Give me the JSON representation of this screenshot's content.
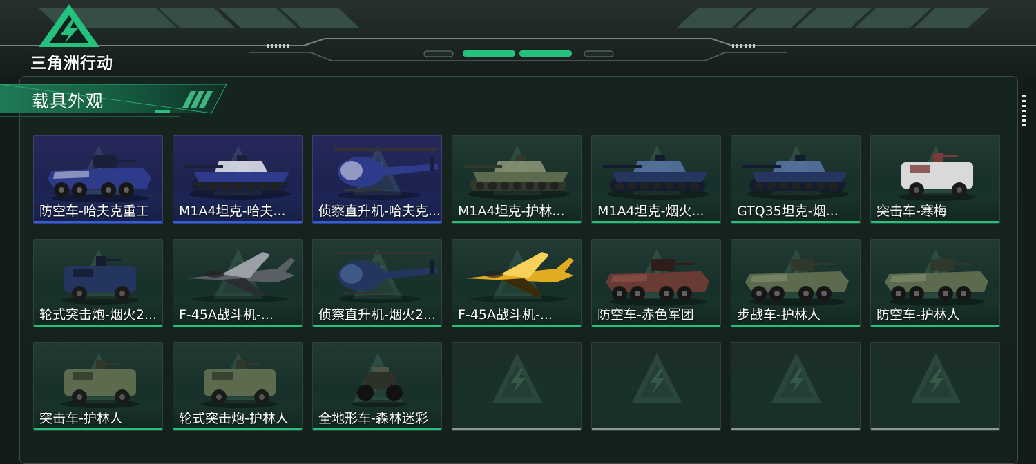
{
  "app": {
    "title": "三角洲行动"
  },
  "section": {
    "title": "载具外观"
  },
  "colors": {
    "accent": "#25c27e",
    "blue_rarity": "#2f5fe0",
    "empty": "#8d9894",
    "panel": "#16241f"
  },
  "vehicles": [
    {
      "label": "防空车-哈夫克重工",
      "rarity": "blue",
      "kind": "wheeled-aa",
      "palette": "hawk"
    },
    {
      "label": "M1A4坦克-哈夫...",
      "rarity": "blue",
      "kind": "tank",
      "palette": "hawk"
    },
    {
      "label": "侦察直升机-哈夫克...",
      "rarity": "blue",
      "kind": "heli",
      "palette": "hawk"
    },
    {
      "label": "M1A4坦克-护林...",
      "rarity": "green",
      "kind": "tank",
      "palette": "camo"
    },
    {
      "label": "M1A4坦克-烟火...",
      "rarity": "green",
      "kind": "tank",
      "palette": "navy"
    },
    {
      "label": "GTQ35坦克-烟...",
      "rarity": "green",
      "kind": "tank",
      "palette": "navy"
    },
    {
      "label": "突击车-寒梅",
      "rarity": "green",
      "kind": "mrap",
      "palette": "white"
    },
    {
      "label": "轮式突击炮-烟火2...",
      "rarity": "green",
      "kind": "mrap",
      "palette": "navy"
    },
    {
      "label": "F-45A战斗机-...",
      "rarity": "green",
      "kind": "jet",
      "palette": "digital"
    },
    {
      "label": "侦察直升机-烟火2...",
      "rarity": "green",
      "kind": "heli",
      "palette": "navy"
    },
    {
      "label": "F-45A战斗机-...",
      "rarity": "green",
      "kind": "jet",
      "palette": "yellow"
    },
    {
      "label": "防空车-赤色军团",
      "rarity": "green",
      "kind": "wheeled-aa",
      "palette": "red"
    },
    {
      "label": "步战车-护林人",
      "rarity": "green",
      "kind": "wheeled-aa",
      "palette": "camo"
    },
    {
      "label": "防空车-护林人",
      "rarity": "green",
      "kind": "wheeled-aa",
      "palette": "camo"
    },
    {
      "label": "突击车-护林人",
      "rarity": "green",
      "kind": "mrap",
      "palette": "camo"
    },
    {
      "label": "轮式突击炮-护林人",
      "rarity": "green",
      "kind": "mrap",
      "palette": "camo"
    },
    {
      "label": "全地形车-森林迷彩",
      "rarity": "green",
      "kind": "atv",
      "palette": "dark"
    },
    {
      "label": "",
      "rarity": "empty"
    },
    {
      "label": "",
      "rarity": "empty"
    },
    {
      "label": "",
      "rarity": "empty"
    },
    {
      "label": "",
      "rarity": "empty"
    }
  ]
}
